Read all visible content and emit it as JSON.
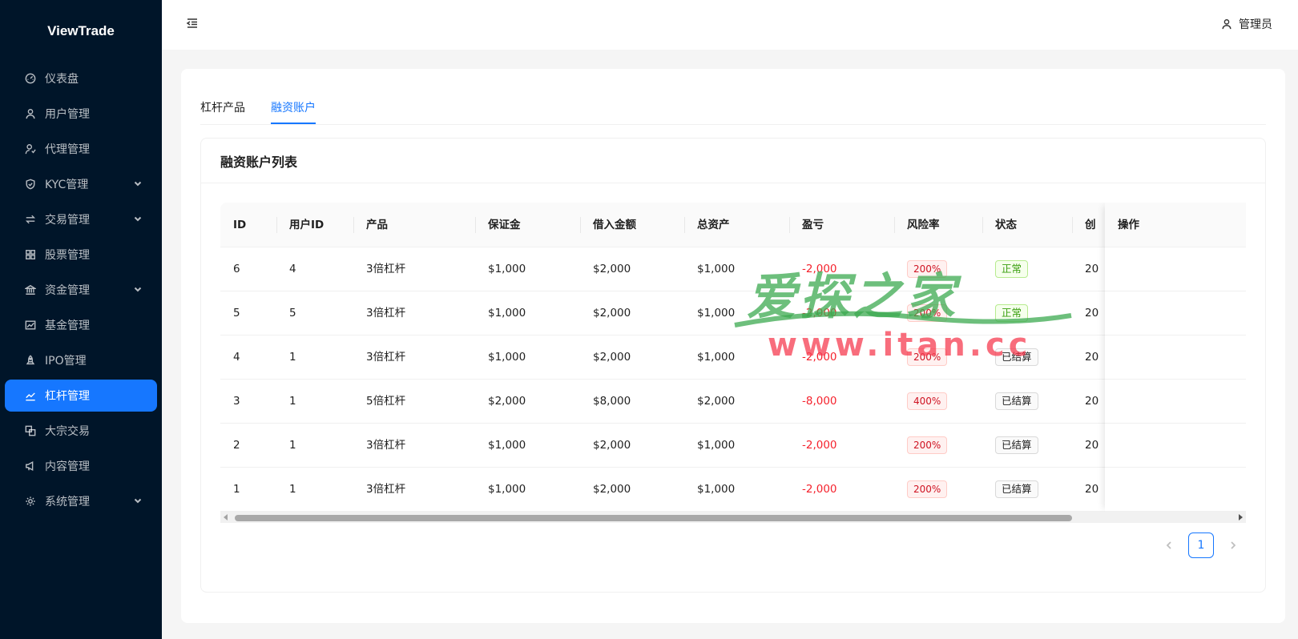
{
  "app": {
    "logo": "ViewTrade"
  },
  "sidebar": {
    "items": [
      {
        "label": "仪表盘",
        "icon": "dashboard-icon",
        "has_arrow": false,
        "active": false
      },
      {
        "label": "用户管理",
        "icon": "user-icon",
        "has_arrow": false,
        "active": false
      },
      {
        "label": "代理管理",
        "icon": "agent-icon",
        "has_arrow": false,
        "active": false
      },
      {
        "label": "KYC管理",
        "icon": "shield-icon",
        "has_arrow": true,
        "active": false
      },
      {
        "label": "交易管理",
        "icon": "swap-icon",
        "has_arrow": true,
        "active": false
      },
      {
        "label": "股票管理",
        "icon": "grid-icon",
        "has_arrow": false,
        "active": false
      },
      {
        "label": "资金管理",
        "icon": "bank-icon",
        "has_arrow": true,
        "active": false
      },
      {
        "label": "基金管理",
        "icon": "fund-icon",
        "has_arrow": false,
        "active": false
      },
      {
        "label": "IPO管理",
        "icon": "rocket-icon",
        "has_arrow": false,
        "active": false
      },
      {
        "label": "杠杆管理",
        "icon": "chart-line-icon",
        "has_arrow": false,
        "active": true
      },
      {
        "label": "大宗交易",
        "icon": "block-icon",
        "has_arrow": false,
        "active": false
      },
      {
        "label": "内容管理",
        "icon": "megaphone-icon",
        "has_arrow": false,
        "active": false
      },
      {
        "label": "系统管理",
        "icon": "gear-icon",
        "has_arrow": true,
        "active": false
      }
    ]
  },
  "header": {
    "user_label": "管理员"
  },
  "tabs": {
    "leverage_products": "杠杆产品",
    "margin_accounts": "融资账户"
  },
  "card": {
    "title": "融资账户列表"
  },
  "table": {
    "columns": {
      "id": "ID",
      "user_id": "用户ID",
      "product": "产品",
      "margin": "保证金",
      "borrowed": "借入金额",
      "total_assets": "总资产",
      "pnl": "盈亏",
      "risk": "风险率",
      "status": "状态",
      "created": "创",
      "actions": "操作"
    },
    "rows": [
      {
        "id": "6",
        "user_id": "4",
        "product": "3倍杠杆",
        "margin": "$1,000",
        "borrowed": "$2,000",
        "total_assets": "$1,000",
        "pnl": "-2,000",
        "risk": "200%",
        "status": "正常",
        "status_type": "normal",
        "created": "20"
      },
      {
        "id": "5",
        "user_id": "5",
        "product": "3倍杠杆",
        "margin": "$1,000",
        "borrowed": "$2,000",
        "total_assets": "$1,000",
        "pnl": "-2,000",
        "risk": "200%",
        "status": "正常",
        "status_type": "normal",
        "created": "20"
      },
      {
        "id": "4",
        "user_id": "1",
        "product": "3倍杠杆",
        "margin": "$1,000",
        "borrowed": "$2,000",
        "total_assets": "$1,000",
        "pnl": "-2,000",
        "risk": "200%",
        "status": "已结算",
        "status_type": "settled",
        "created": "20"
      },
      {
        "id": "3",
        "user_id": "1",
        "product": "5倍杠杆",
        "margin": "$2,000",
        "borrowed": "$8,000",
        "total_assets": "$2,000",
        "pnl": "-8,000",
        "risk": "400%",
        "status": "已结算",
        "status_type": "settled",
        "created": "20"
      },
      {
        "id": "2",
        "user_id": "1",
        "product": "3倍杠杆",
        "margin": "$1,000",
        "borrowed": "$2,000",
        "total_assets": "$1,000",
        "pnl": "-2,000",
        "risk": "200%",
        "status": "已结算",
        "status_type": "settled",
        "created": "20"
      },
      {
        "id": "1",
        "user_id": "1",
        "product": "3倍杠杆",
        "margin": "$1,000",
        "borrowed": "$2,000",
        "total_assets": "$1,000",
        "pnl": "-2,000",
        "risk": "200%",
        "status": "已结算",
        "status_type": "settled",
        "created": "20"
      }
    ]
  },
  "pagination": {
    "current_page": "1"
  },
  "watermark": {
    "top": "爱探之家",
    "bottom": "www.itan.cc"
  },
  "colors": {
    "sidebar_bg": "#001529",
    "accent": "#1677ff",
    "loss": "#f5222d"
  }
}
